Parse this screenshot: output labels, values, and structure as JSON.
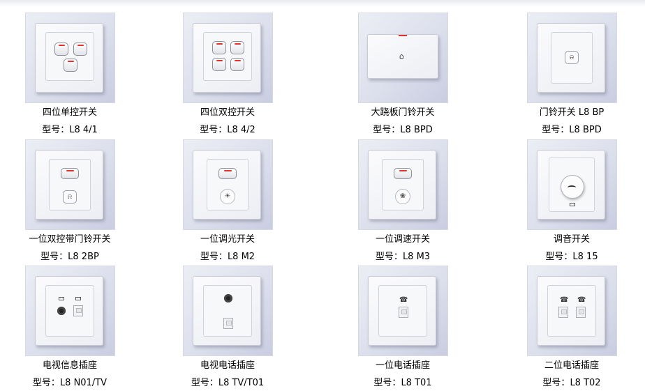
{
  "products": [
    {
      "name": "四位单控开关",
      "model_label": "型号：",
      "model": "L8 4/1",
      "icon": "switch-triple-icon"
    },
    {
      "name": "四位双控开关",
      "model_label": "型号：",
      "model": "L8 4/2",
      "icon": "switch-quad-icon"
    },
    {
      "name": "大跷板门铃开关",
      "model_label": "型号：",
      "model": "L8 BPD",
      "icon": "wide-bell-switch-icon"
    },
    {
      "name": "门铃开关 L8 BP",
      "model_label": "型号：",
      "model": "L8 BPD",
      "icon": "bell-switch-icon"
    },
    {
      "name": "一位双控带门铃开关",
      "model_label": "型号：",
      "model": "L8 2BP",
      "icon": "switch-with-bell-icon"
    },
    {
      "name": "一位调光开关",
      "model_label": "型号：",
      "model": "L8 M2",
      "icon": "dimmer-switch-icon"
    },
    {
      "name": "一位调速开关",
      "model_label": "型号：",
      "model": "L8 M3",
      "icon": "speed-switch-icon"
    },
    {
      "name": "调音开关",
      "model_label": "型号：",
      "model": "L8 15",
      "icon": "volume-knob-icon"
    },
    {
      "name": "电视信息插座",
      "model_label": "型号：",
      "model": "L8 N01/TV",
      "icon": "tv-data-socket-icon"
    },
    {
      "name": "电视电话插座",
      "model_label": "型号：",
      "model": "L8 TV/T01",
      "icon": "tv-phone-socket-icon"
    },
    {
      "name": "一位电话插座",
      "model_label": "型号：",
      "model": "L8 T01",
      "icon": "phone-socket-icon"
    },
    {
      "name": "二位电话插座",
      "model_label": "型号：",
      "model": "L8 T02",
      "icon": "double-phone-socket-icon"
    }
  ],
  "colors": {
    "indicator": "#e2302c",
    "photo_background": "#dcdfec",
    "plate": "#f4f5f8"
  }
}
